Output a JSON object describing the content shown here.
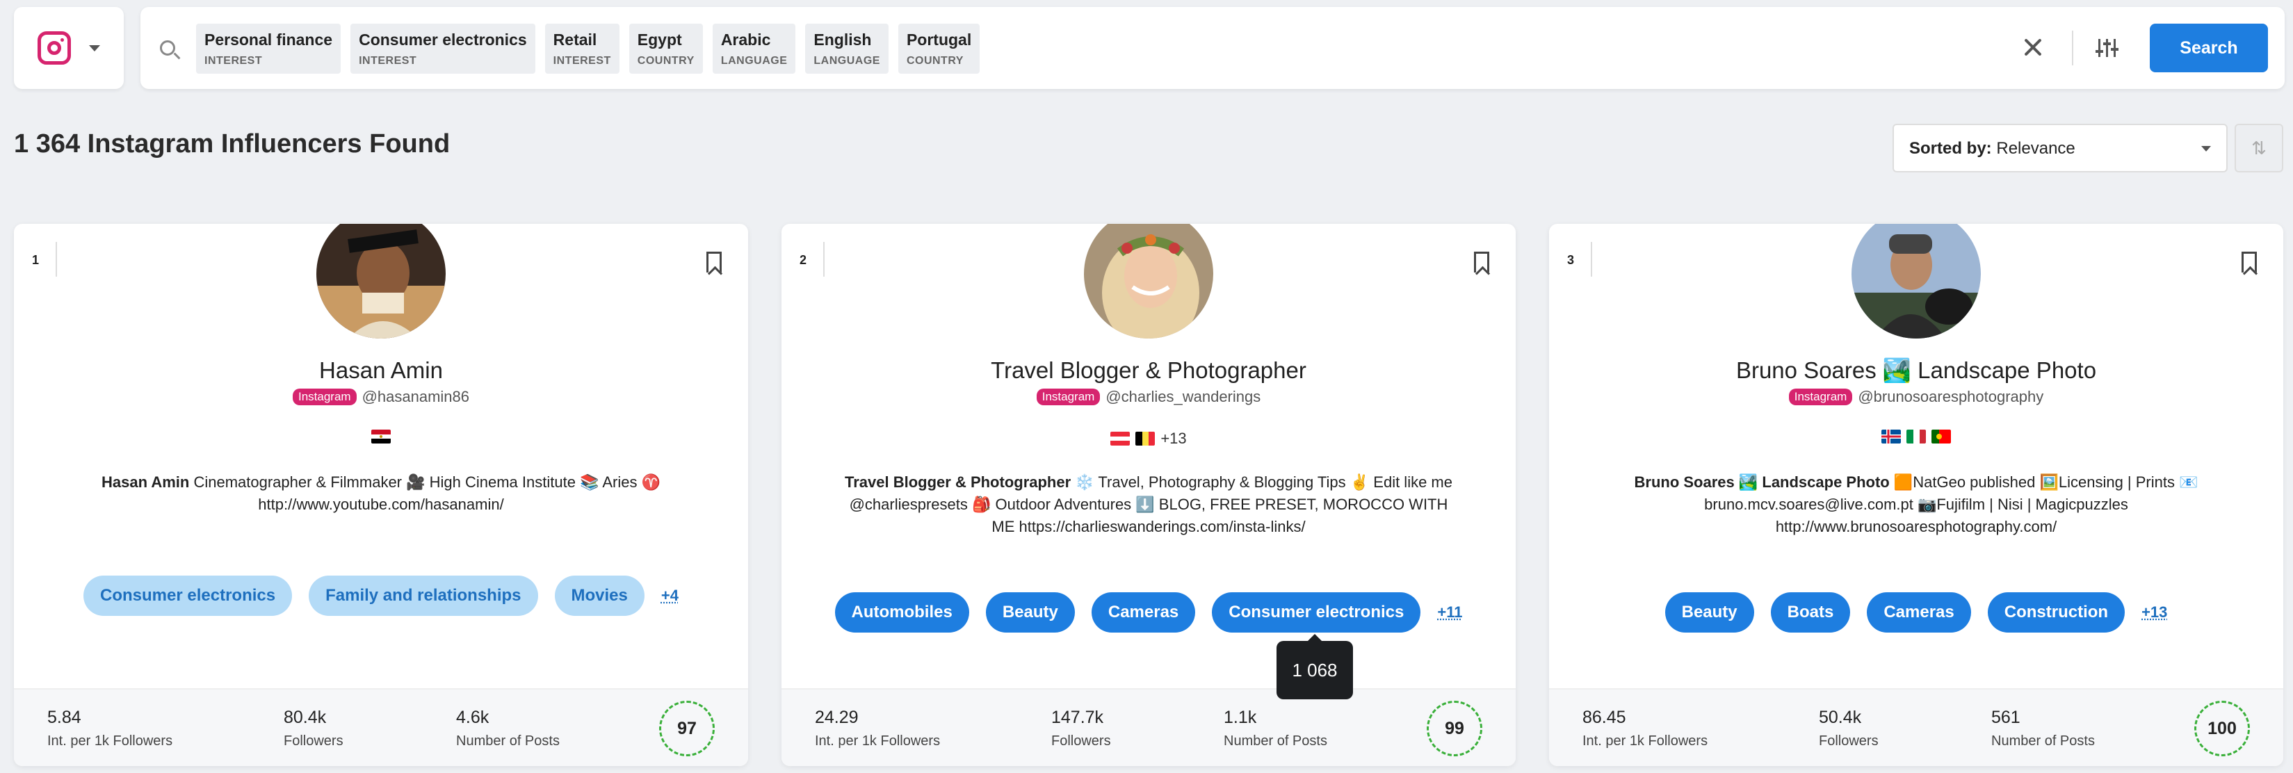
{
  "platform": {
    "icon": "instagram-icon"
  },
  "search": {
    "chips": [
      {
        "name": "Personal finance",
        "type": "INTEREST"
      },
      {
        "name": "Consumer electronics",
        "type": "INTEREST"
      },
      {
        "name": "Retail",
        "type": "INTEREST"
      },
      {
        "name": "Egypt",
        "type": "COUNTRY"
      },
      {
        "name": "Arabic",
        "type": "LANGUAGE"
      },
      {
        "name": "English",
        "type": "LANGUAGE"
      },
      {
        "name": "Portugal",
        "type": "COUNTRY"
      }
    ],
    "button_label": "Search"
  },
  "results": {
    "title": "1 364 Instagram Influencers Found",
    "sort_prefix": "Sorted by:",
    "sort_value": "Relevance"
  },
  "cards": [
    {
      "rank": "1",
      "name": "Hasan Amin",
      "badge": "Instagram",
      "handle": "@hasanamin86",
      "flags_extra": "",
      "bio_bold": "Hasan Amin",
      "bio_rest": " Cinematographer & Filmmaker 🎥 High Cinema Institute 📚 Aries ♈ http://www.youtube.com/hasanamin/",
      "tags": [
        "Consumer electronics",
        "Family and relationships",
        "Movies"
      ],
      "more": "+4",
      "stats": [
        {
          "value": "5.84",
          "label": "Int. per 1k Followers"
        },
        {
          "value": "80.4k",
          "label": "Followers"
        },
        {
          "value": "4.6k",
          "label": "Number of Posts"
        }
      ],
      "score": "97"
    },
    {
      "rank": "2",
      "name": "Travel Blogger & Photographer",
      "badge": "Instagram",
      "handle": "@charlies_wanderings",
      "flags_extra": "+13",
      "bio_bold": "Travel Blogger & Photographer",
      "bio_rest": " ❄️ Travel, Photography & Blogging Tips ✌️ Edit like me @charliespresets 🎒 Outdoor Adventures ⬇️ BLOG, FREE PRESET, MOROCCO WITH ME https://charlieswanderings.com/insta-links/",
      "tags": [
        "Automobiles",
        "Beauty",
        "Cameras",
        "Consumer electronics"
      ],
      "more": "+11",
      "stats": [
        {
          "value": "24.29",
          "label": "Int. per 1k Followers"
        },
        {
          "value": "147.7k",
          "label": "Followers"
        },
        {
          "value": "1.1k",
          "label": "Number of Posts"
        }
      ],
      "score": "99"
    },
    {
      "rank": "3",
      "name": "Bruno Soares 🏞️ Landscape Photo",
      "badge": "Instagram",
      "handle": "@brunosoaresphotography",
      "flags_extra": "",
      "bio_bold": "Bruno Soares 🏞️ Landscape Photo",
      "bio_rest": " 🟧NatGeo published 🖼️Licensing | Prints 📧 bruno.mcv.soares@live.com.pt 📷Fujifilm | Nisi | Magicpuzzles http://www.brunosoaresphotography.com/",
      "tags": [
        "Beauty",
        "Boats",
        "Cameras",
        "Construction"
      ],
      "more": "+13",
      "stats": [
        {
          "value": "86.45",
          "label": "Int. per 1k Followers"
        },
        {
          "value": "50.4k",
          "label": "Followers"
        },
        {
          "value": "561",
          "label": "Number of Posts"
        }
      ],
      "score": "100"
    }
  ],
  "tooltip": {
    "text": "1 068"
  }
}
